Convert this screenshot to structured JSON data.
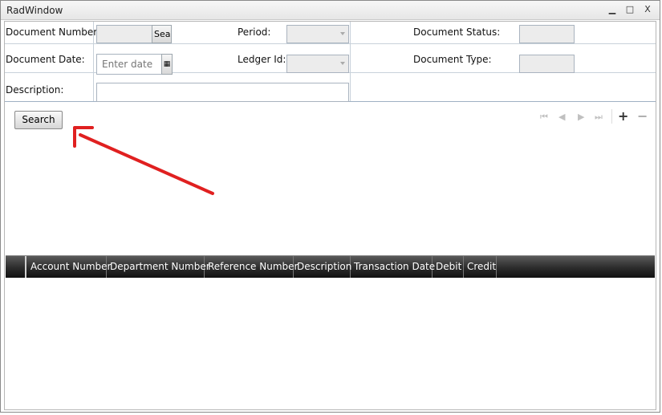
{
  "window": {
    "title": "RadWindow",
    "minimize": "▁",
    "maximize": "□",
    "close": "X"
  },
  "form": {
    "document_number_label": "Document Number:",
    "search_small_label": "Sea",
    "period_label": "Period:",
    "document_status_label": "Document Status:",
    "document_date_label": "Document Date:",
    "date_placeholder": "Enter date",
    "calendar_icon": "▦",
    "ledger_id_label": "Ledger Id:",
    "document_type_label": "Document Type:",
    "description_label": "Description:"
  },
  "toolbar": {
    "search_label": "Search"
  },
  "pager": {
    "first": "⏮",
    "prev": "◀",
    "next": "▶",
    "last": "⏭",
    "add": "+",
    "remove": "−"
  },
  "grid": {
    "columns": [
      "Account Number",
      "Department Number",
      "Reference Number",
      "Description",
      "Transaction Date",
      "Debit",
      "Credit"
    ]
  },
  "annotation": {
    "color": "#e02020"
  }
}
